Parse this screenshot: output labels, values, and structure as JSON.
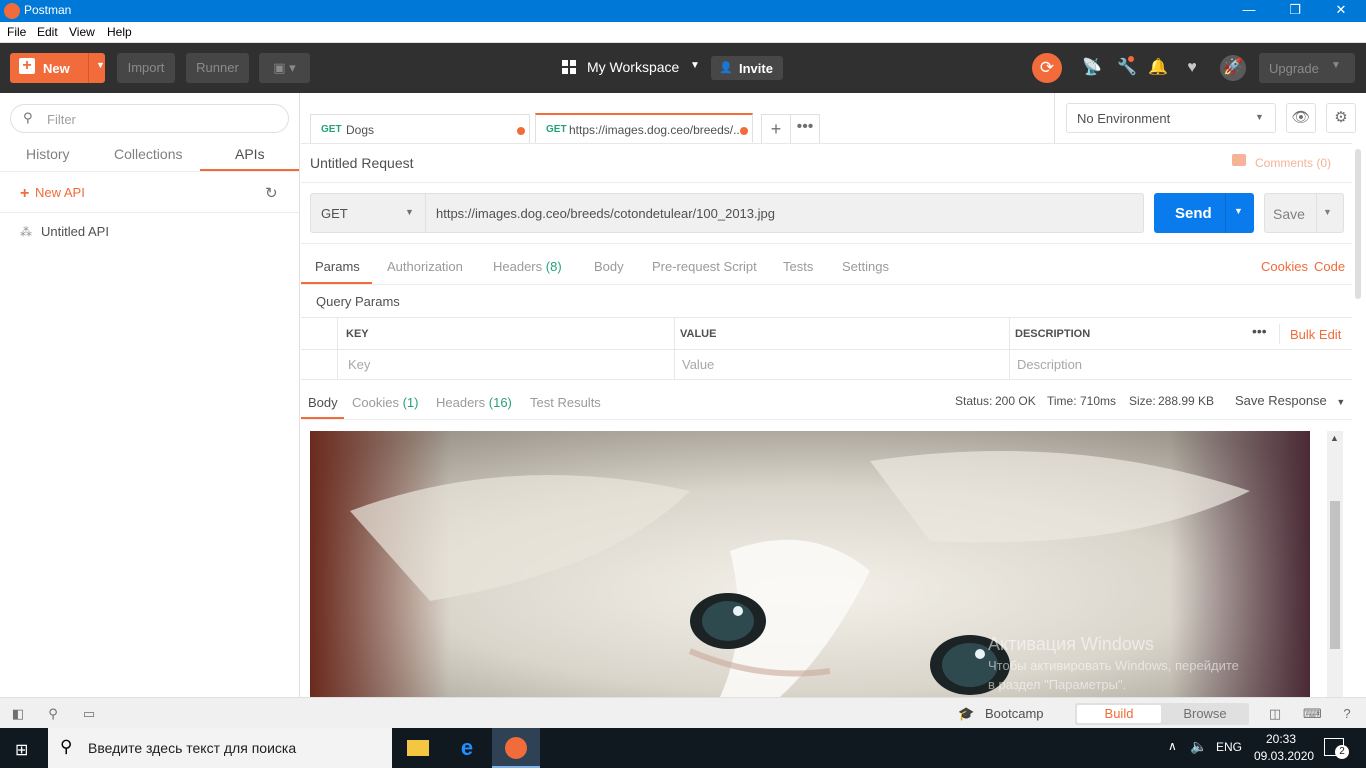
{
  "window": {
    "title": "Postman",
    "minimize": "—",
    "restore": "❐",
    "close": "✕"
  },
  "menu": [
    "File",
    "Edit",
    "View",
    "Help"
  ],
  "header": {
    "new_label": "New",
    "import_label": "Import",
    "runner_label": "Runner",
    "workspace_label": "My Workspace",
    "invite_label": "Invite",
    "upgrade_label": "Upgrade",
    "accent": "#f26b3a"
  },
  "sidebar": {
    "filter_placeholder": "Filter",
    "tabs": [
      "History",
      "Collections",
      "APIs"
    ],
    "active_tab": "APIs",
    "new_api_label": "New API",
    "items": [
      {
        "label": "Untitled API"
      }
    ]
  },
  "tabs": [
    {
      "method": "GET",
      "title": "Dogs",
      "unsaved": true
    },
    {
      "method": "GET",
      "title": "https://images.dog.ceo/breeds/...",
      "unsaved": true
    }
  ],
  "environment": {
    "selected": "No Environment"
  },
  "request": {
    "name": "Untitled Request",
    "comments_label": "Comments (0)",
    "method": "GET",
    "url": "https://images.dog.ceo/breeds/cotondetulear/100_2013.jpg",
    "send_label": "Send",
    "save_label": "Save",
    "subtabs": {
      "params": "Params",
      "authorization": "Authorization",
      "headers": "Headers",
      "headers_count": "(8)",
      "body": "Body",
      "prerequest": "Pre-request Script",
      "tests": "Tests",
      "settings": "Settings"
    },
    "cookies_link": "Cookies",
    "code_link": "Code",
    "query_params_title": "Query Params",
    "table": {
      "headers": [
        "KEY",
        "VALUE",
        "DESCRIPTION"
      ],
      "placeholders": [
        "Key",
        "Value",
        "Description"
      ],
      "bulk_edit_label": "Bulk Edit"
    }
  },
  "response": {
    "tabs": {
      "body": "Body",
      "cookies": "Cookies",
      "cookies_count": "(1)",
      "headers": "Headers",
      "headers_count": "(16)",
      "test_results": "Test Results"
    },
    "status_label": "Status:",
    "status_value": "200 OK",
    "time_label": "Time:",
    "time_value": "710ms",
    "size_label": "Size:",
    "size_value": "288.99 KB",
    "save_response_label": "Save Response",
    "watermark_title": "Активация Windows",
    "watermark_line1": "Чтобы активировать Windows, перейдите",
    "watermark_line2": "в раздел \"Параметры\"."
  },
  "statusbar": {
    "bootcamp_label": "Bootcamp",
    "build_label": "Build",
    "browse_label": "Browse"
  },
  "taskbar": {
    "search_placeholder": "Введите здесь текст для поиска",
    "language": "ENG",
    "time": "20:33",
    "date": "09.03.2020",
    "notifications": "2"
  }
}
